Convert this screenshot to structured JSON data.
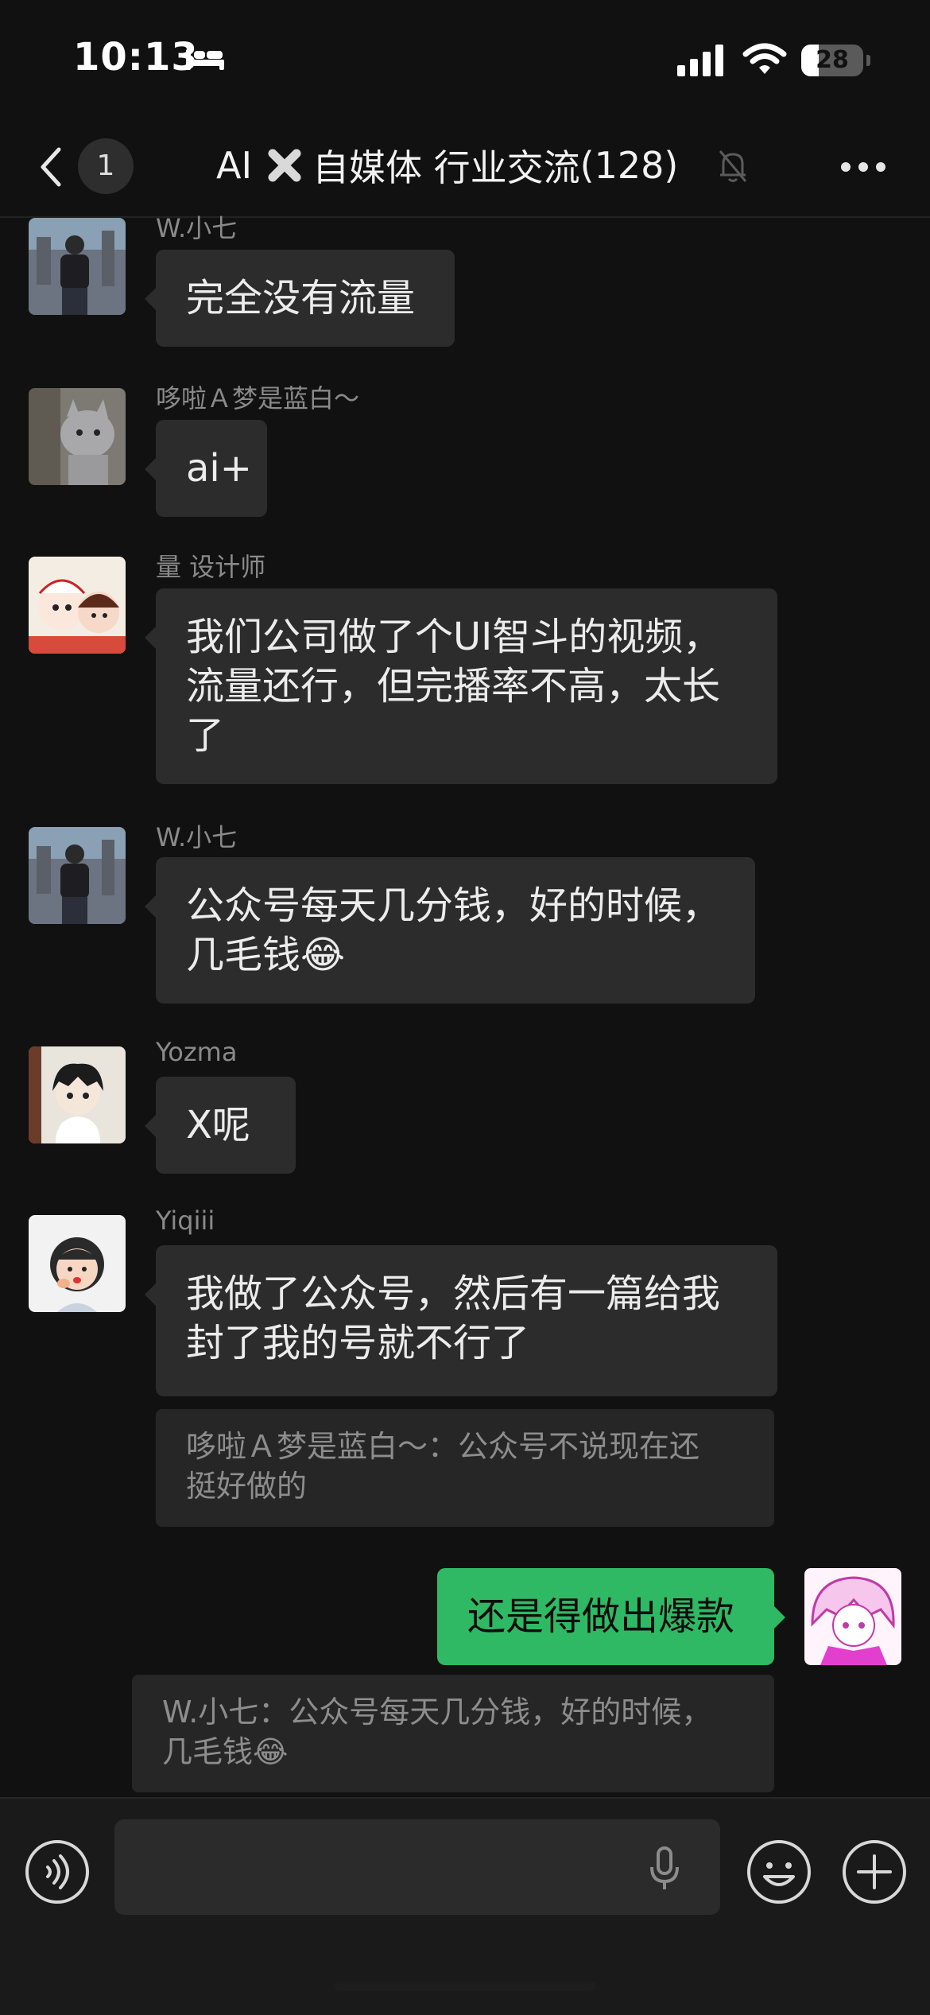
{
  "status_bar": {
    "time": "10:13",
    "battery": "28",
    "battery_level": 0.28,
    "icons": [
      "bed-icon",
      "cellular-signal-icon",
      "wifi-icon",
      "battery-icon"
    ]
  },
  "nav": {
    "unread_count": "1",
    "title_prefix": "AI",
    "title_suffix": "自媒体 行业交流",
    "member_count": "(128)",
    "icons": [
      "back-chevron-icon",
      "cross-mark-icon",
      "muted-bell-icon",
      "more-dots-icon"
    ]
  },
  "messages": [
    {
      "sender": "W.小七",
      "text": "完全没有流量",
      "avatar": "avatar-city-photo"
    },
    {
      "sender": "哆啦Ａ梦是蓝白～",
      "text": "ai+",
      "avatar": "avatar-cat-photo"
    },
    {
      "sender": "量 设计师",
      "lines": [
        "我们公司做了个UI智斗的视频，",
        "流量还行，但完播率不高，太长",
        "了"
      ],
      "avatar": "avatar-cartoon-pair"
    },
    {
      "sender": "W.小七",
      "lines": [
        "公众号每天几分钱，好的时候，",
        "几毛钱😂"
      ],
      "avatar": "avatar-city-photo"
    },
    {
      "sender": "Yozma",
      "text": "X呢",
      "avatar": "avatar-anime-boy"
    },
    {
      "sender": "Yiqiii",
      "lines": [
        "我做了公众号，然后有一篇给我",
        "封了我的号就不行了"
      ],
      "avatar": "avatar-cartoon-girl"
    }
  ],
  "quote_1": {
    "lines": [
      "哆啦Ａ梦是蓝白～：公众号不说现在还",
      "挺好做的"
    ]
  },
  "my_message": {
    "text": "还是得做出爆款",
    "avatar": "avatar-pink-anime"
  },
  "quote_2": {
    "lines": [
      "W.小七：公众号每天几分钱，好的时候，",
      "几毛钱😂"
    ]
  },
  "input_bar": {
    "icons": [
      "voice-input-icon",
      "microphone-icon",
      "emoji-icon",
      "add-plus-icon"
    ]
  },
  "colors": {
    "background": "#111111",
    "bubble_other": "#2c2c2c",
    "bubble_mine": "#2fb964",
    "sender_name": "#8a8a8a",
    "quote_text": "#8d8d8d"
  }
}
